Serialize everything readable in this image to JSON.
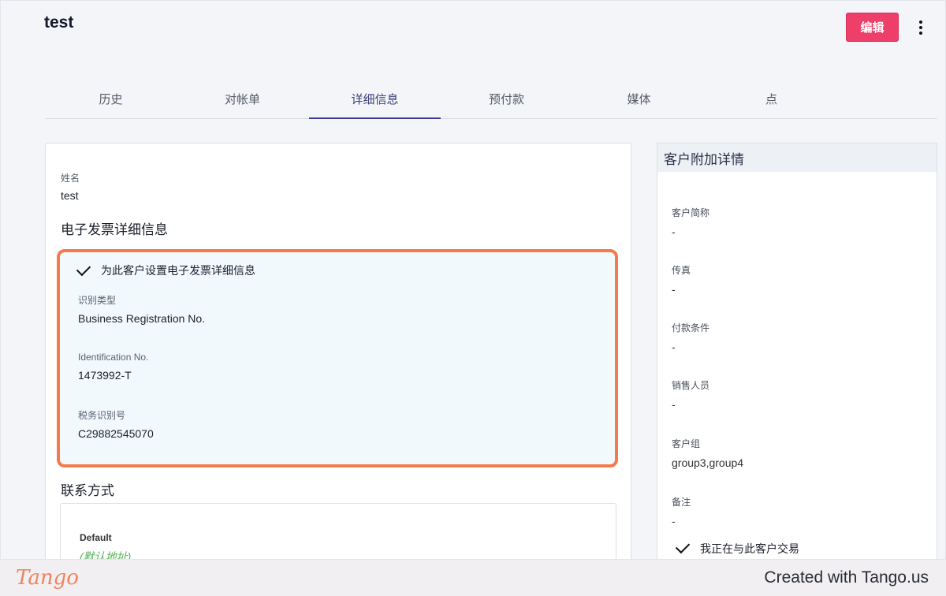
{
  "header": {
    "title": "test",
    "edit_label": "编辑"
  },
  "tabs": [
    {
      "label": "历史",
      "active": false
    },
    {
      "label": "对帐单",
      "active": false
    },
    {
      "label": "详细信息",
      "active": true
    },
    {
      "label": "预付款",
      "active": false
    },
    {
      "label": "媒体",
      "active": false
    },
    {
      "label": "点",
      "active": false
    }
  ],
  "details": {
    "name_label": "姓名",
    "name_value": "test",
    "einvoice_heading": "电子发票详细信息",
    "einvoice_checkbox_label": "为此客户设置电子发票详细信息",
    "einvoice_checked": true,
    "id_type_label": "识别类型",
    "id_type_value": "Business Registration No.",
    "id_no_label": "Identification No.",
    "id_no_value": "1473992-T",
    "tax_id_label": "税务识别号",
    "tax_id_value": "C29882545070",
    "contact_heading": "联系方式",
    "contact_default_label": "Default",
    "contact_default_note": "(默认地址)"
  },
  "side": {
    "heading": "客户附加详情",
    "fields": [
      {
        "label": "客户简称",
        "value": "-"
      },
      {
        "label": "传真",
        "value": "-"
      },
      {
        "label": "付款条件",
        "value": "-"
      },
      {
        "label": "销售人员",
        "value": "-"
      },
      {
        "label": "客户组",
        "value": "group3,group4"
      },
      {
        "label": "备注",
        "value": "-"
      }
    ],
    "trading_label": "我正在与此客户交易",
    "trading_checked": true
  },
  "footer": {
    "logo_text": "Tango",
    "credit": "Created with Tango.us"
  },
  "colors": {
    "accent": "#ee3f6b",
    "tab_underline": "#3f3a96",
    "highlight_border": "#f47b4a",
    "tango_orange": "#f0845c"
  }
}
